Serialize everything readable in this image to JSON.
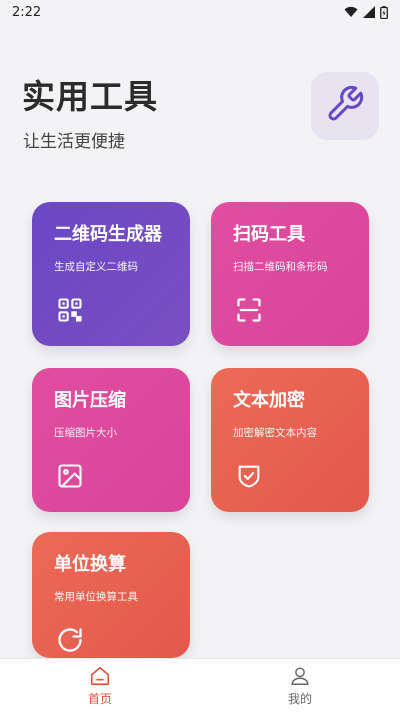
{
  "status_bar": {
    "time": "2:22"
  },
  "header": {
    "title": "实用工具",
    "subtitle": "让生活更便捷",
    "settings_icon": "wrench-icon"
  },
  "colors": {
    "purple": "#6a47c6",
    "pink": "#de4c9f",
    "red": "#e8604f",
    "nav_active": "#e0553b"
  },
  "tools": [
    {
      "title": "二维码生成器",
      "desc": "生成自定义二维码",
      "icon": "qr-code-icon"
    },
    {
      "title": "扫码工具",
      "desc": "扫描二维码和条形码",
      "icon": "scan-icon"
    },
    {
      "title": "图片压缩",
      "desc": "压缩图片大小",
      "icon": "image-icon"
    },
    {
      "title": "文本加密",
      "desc": "加密解密文本内容",
      "icon": "shield-check-icon"
    },
    {
      "title": "单位换算",
      "desc": "常用单位换算工具",
      "icon": "refresh-icon"
    }
  ],
  "bottom_nav": [
    {
      "label": "首页",
      "icon": "home-icon",
      "active": true
    },
    {
      "label": "我的",
      "icon": "user-icon",
      "active": false
    }
  ]
}
